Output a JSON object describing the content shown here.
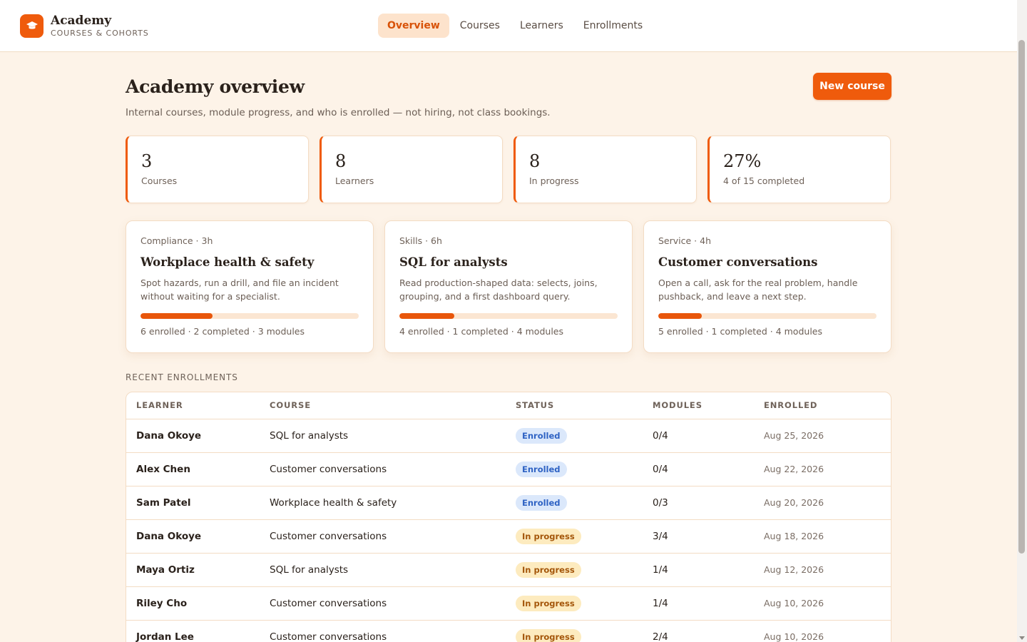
{
  "brand": {
    "name": "Academy",
    "subtitle": "COURSES & COHORTS",
    "icon": "graduation-cap-icon"
  },
  "nav": [
    {
      "label": "Overview",
      "active": true
    },
    {
      "label": "Courses",
      "active": false
    },
    {
      "label": "Learners",
      "active": false
    },
    {
      "label": "Enrollments",
      "active": false
    }
  ],
  "page": {
    "title": "Academy overview",
    "subtitle": "Internal courses, module progress, and who is enrolled — not hiring, not class bookings.",
    "primary_action": "New course"
  },
  "stats": [
    {
      "value": "3",
      "label": "Courses"
    },
    {
      "value": "8",
      "label": "Learners"
    },
    {
      "value": "8",
      "label": "In progress"
    },
    {
      "value": "27%",
      "label": "4 of 15 completed"
    }
  ],
  "courses": [
    {
      "meta": "Compliance · 3h",
      "title": "Workplace health & safety",
      "description": "Spot hazards, run a drill, and file an incident without waiting for a specialist.",
      "progress": 0.33,
      "footer": "6 enrolled · 2 completed · 3 modules"
    },
    {
      "meta": "Skills · 6h",
      "title": "SQL for analysts",
      "description": "Read production-shaped data: selects, joins, grouping, and a first dashboard query.",
      "progress": 0.25,
      "footer": "4 enrolled · 1 completed · 4 modules"
    },
    {
      "meta": "Service · 4h",
      "title": "Customer conversations",
      "description": "Open a call, ask for the real problem, handle pushback, and leave a next step.",
      "progress": 0.2,
      "footer": "5 enrolled · 1 completed · 4 modules"
    }
  ],
  "enrollments": {
    "section_label": "RECENT ENROLLMENTS",
    "headers": [
      "LEARNER",
      "COURSE",
      "STATUS",
      "MODULES",
      "ENROLLED"
    ],
    "rows": [
      {
        "learner": "Dana Okoye",
        "course": "SQL for analysts",
        "status": "Enrolled",
        "status_type": "enrolled",
        "modules": "0/4",
        "enrolled": "Aug 25, 2026"
      },
      {
        "learner": "Alex Chen",
        "course": "Customer conversations",
        "status": "Enrolled",
        "status_type": "enrolled",
        "modules": "0/4",
        "enrolled": "Aug 22, 2026"
      },
      {
        "learner": "Sam Patel",
        "course": "Workplace health & safety",
        "status": "Enrolled",
        "status_type": "enrolled",
        "modules": "0/3",
        "enrolled": "Aug 20, 2026"
      },
      {
        "learner": "Dana Okoye",
        "course": "Customer conversations",
        "status": "In progress",
        "status_type": "progress",
        "modules": "3/4",
        "enrolled": "Aug 18, 2026"
      },
      {
        "learner": "Maya Ortiz",
        "course": "SQL for analysts",
        "status": "In progress",
        "status_type": "progress",
        "modules": "1/4",
        "enrolled": "Aug 12, 2026"
      },
      {
        "learner": "Riley Cho",
        "course": "Customer conversations",
        "status": "In progress",
        "status_type": "progress",
        "modules": "1/4",
        "enrolled": "Aug 10, 2026"
      },
      {
        "learner": "Jordan Lee",
        "course": "Customer conversations",
        "status": "In progress",
        "status_type": "progress",
        "modules": "2/4",
        "enrolled": "Aug 10, 2026"
      }
    ]
  },
  "colors": {
    "accent": "#ef5b0c",
    "background": "#fdf3e8",
    "enrolled_badge": "#dbe8fb",
    "progress_badge": "#fdebbf"
  }
}
